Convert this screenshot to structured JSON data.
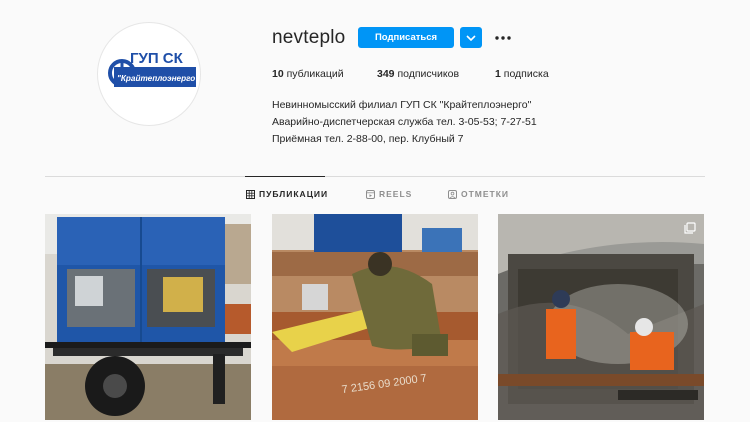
{
  "profile": {
    "username": "nevteplo",
    "follow_label": "Подписаться",
    "logo_line1": "ГУП СК",
    "logo_line2": "\"Крайтеплоэнерго\""
  },
  "stats": {
    "posts_count": "10",
    "posts_label": "публикаций",
    "followers_count": "349",
    "followers_label": "подписчиков",
    "following_count": "1",
    "following_label": "подписка"
  },
  "bio": {
    "line1": "Невинномысский филиал ГУП СК \"Крайтеплоэнерго\"",
    "line2": "Аварийно-диспетчерская служба тел. 3-05-53; 7-27-51",
    "line3": "Приёмная тел. 2-88-00, пер. Клубный 7"
  },
  "tabs": [
    {
      "label": "ПУБЛИКАЦИИ",
      "icon": "grid-icon",
      "active": true
    },
    {
      "label": "REELS",
      "icon": "reels-icon",
      "active": false
    },
    {
      "label": "ОТМЕТКИ",
      "icon": "tagged-icon",
      "active": false
    }
  ],
  "posts": [
    {
      "subject": "blue generator trailer"
    },
    {
      "subject": "worker welding pipes",
      "marking": "7 2156 09 2000 7"
    },
    {
      "subject": "workers in pipe trench",
      "badge": "multi-photo-icon"
    }
  ],
  "colors": {
    "accent": "#0095f6",
    "background": "#fafafa",
    "divider": "#dbdbdb",
    "muted": "#8e8e8e"
  }
}
